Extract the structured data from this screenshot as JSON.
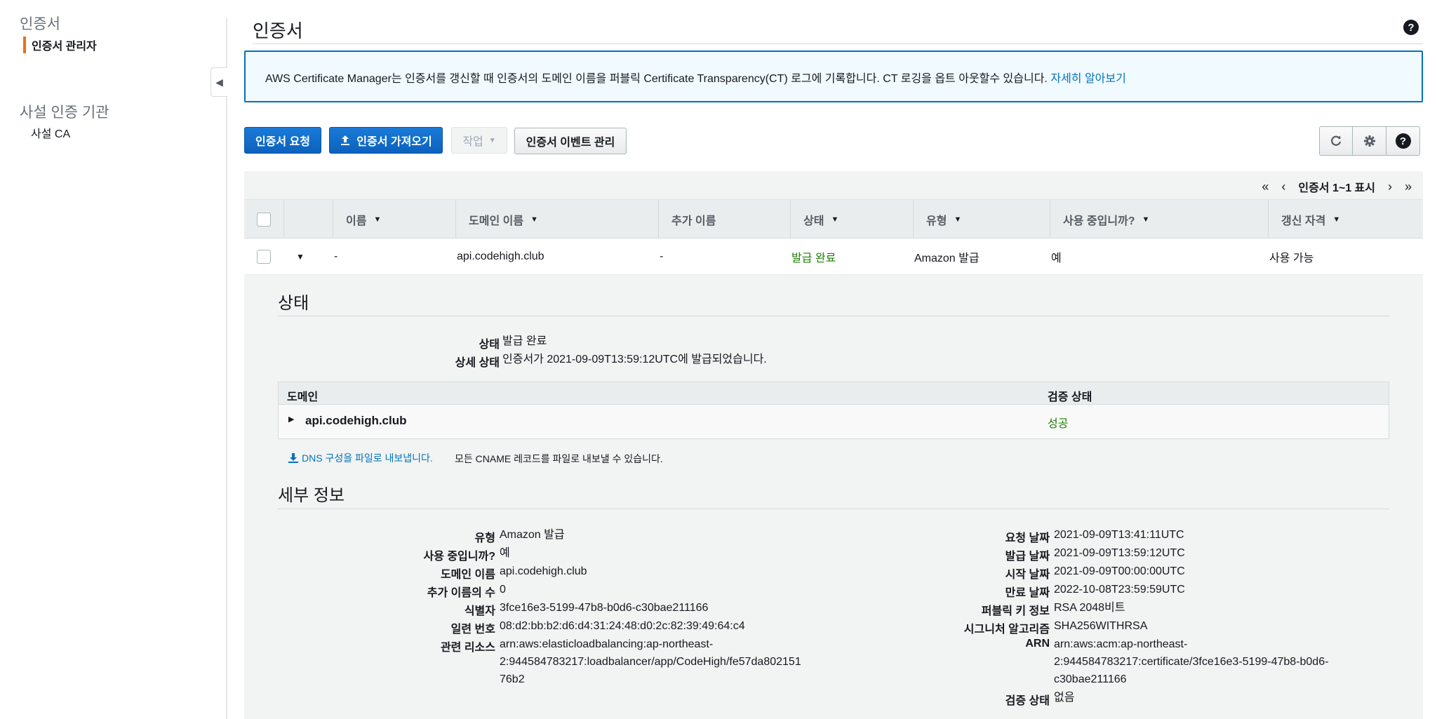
{
  "sidebar": {
    "groups": [
      {
        "title": "인증서",
        "items": [
          "인증서 관리자"
        ]
      },
      {
        "title": "사설 인증 기관",
        "items": [
          "사설 CA"
        ]
      }
    ]
  },
  "page": {
    "title": "인증서"
  },
  "info": {
    "text": "AWS Certificate Manager는 인증서를 갱신할 때 인증서의 도메인 이름을 퍼블릭 Certificate Transparency(CT) 로그에 기록합니다. CT 로깅을 옵트 아웃할수 있습니다.",
    "link": "자세히 알아보기"
  },
  "toolbar": {
    "request": "인증서 요청",
    "import": "인증서 가져오기",
    "actions": "작업",
    "events": "인증서 이벤트 관리"
  },
  "pager": {
    "text": "인증서 1~1 표시"
  },
  "table": {
    "headers": [
      "이름",
      "도메인 이름",
      "추가 이름",
      "상태",
      "유형",
      "사용 중입니까?",
      "갱신 자격"
    ],
    "row": [
      "-",
      "api.codehigh.club",
      "-",
      "발급 완료",
      "Amazon 발급",
      "예",
      "사용 가능"
    ]
  },
  "status_section": {
    "title": "상태",
    "status_label": "상태",
    "status_value": "발급 완료",
    "detail_label": "상세 상태",
    "detail_value": "인증서가 2021-09-09T13:59:12UTC에 발급되었습니다.",
    "domain_header": "도메인",
    "validation_header": "검증 상태",
    "domain": "api.codehigh.club",
    "validation": "성공",
    "export_link": "DNS 구성을 파일로 내보냅니다.",
    "export_note": "모든 CNAME 레코드를 파일로 내보낼 수 있습니다."
  },
  "details": {
    "title": "세부 정보",
    "left": [
      {
        "label": "유형",
        "value": "Amazon 발급"
      },
      {
        "label": "사용 중입니까?",
        "value": "예"
      },
      {
        "label": "도메인 이름",
        "value": "api.codehigh.club"
      },
      {
        "label": "추가 이름의 수",
        "value": "0"
      },
      {
        "label": "식별자",
        "value": "3fce16e3-5199-47b8-b0d6-c30bae211166"
      },
      {
        "label": "일련 번호",
        "value": "08:d2:bb:b2:d6:d4:31:24:48:d0:2c:82:39:49:64:c4"
      },
      {
        "label": "관련 리소스",
        "value_lines": [
          "arn:aws:elasticloadbalancing:ap-northeast-",
          "2:944584783217:loadbalancer/app/CodeHigh/fe57da802151",
          "76b2"
        ]
      }
    ],
    "right": [
      {
        "label": "요청 날짜",
        "value": "2021-09-09T13:41:11UTC"
      },
      {
        "label": "발급 날짜",
        "value": "2021-09-09T13:59:12UTC"
      },
      {
        "label": "시작 날짜",
        "value": "2021-09-09T00:00:00UTC"
      },
      {
        "label": "만료 날짜",
        "value": "2022-10-08T23:59:59UTC"
      },
      {
        "label": "퍼블릭 키 정보",
        "value": "RSA 2048비트"
      },
      {
        "label": "시그니처 알고리즘",
        "value": "SHA256WITHRSA"
      },
      {
        "label": "ARN",
        "value_lines": [
          "arn:aws:acm:ap-northeast-",
          "2:944584783217:certificate/3fce16e3-5199-47b8-b0d6-",
          "c30bae211166"
        ]
      },
      {
        "label": "검증 상태",
        "value": "없음"
      }
    ]
  },
  "colors": {
    "primary": "#0d6fd1",
    "accent": "#ec7211",
    "success": "#1d8102",
    "link": "#0073bb"
  }
}
